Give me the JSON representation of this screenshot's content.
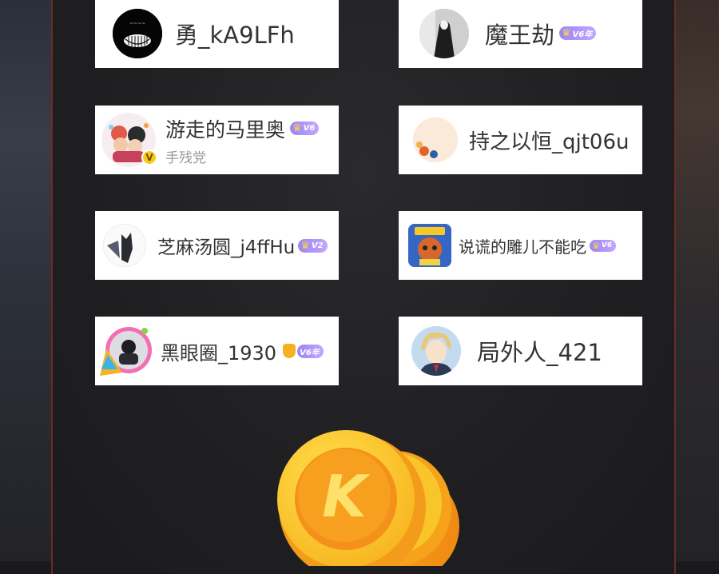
{
  "users": [
    {
      "name": "勇_kA9LFh"
    },
    {
      "name": "魔王劫",
      "badge": "V6年"
    },
    {
      "name": "游走的马里奥",
      "badge": "V6",
      "subtitle": "手残党",
      "avatar_badge": "V"
    },
    {
      "name": "持之以恒_qjt06u"
    },
    {
      "name": "芝麻汤圆_j4ffHu",
      "badge": "V2"
    },
    {
      "name": "说谎的雕儿不能吃",
      "badge": "V6"
    },
    {
      "name": "黑眼圈_1930",
      "badge": "V6年"
    },
    {
      "name": "局外人_421"
    }
  ],
  "coin": {
    "letter": "K"
  },
  "colors": {
    "card_bg": "#ffffff",
    "panel_bg": "#1f1f21",
    "panel_border": "#6a2c22",
    "vip_purple": "#9b86f2",
    "coin_orange": "#f39b1a",
    "coin_yellow": "#fbd03a"
  }
}
